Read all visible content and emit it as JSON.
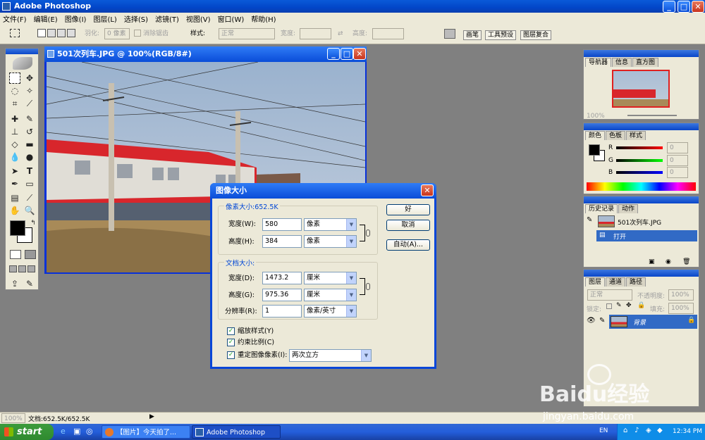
{
  "app": {
    "title": "Adobe Photoshop"
  },
  "menu": [
    "文件(F)",
    "编辑(E)",
    "图像(I)",
    "图层(L)",
    "选择(S)",
    "滤镜(T)",
    "视图(V)",
    "窗口(W)",
    "帮助(H)"
  ],
  "options": {
    "feather_label": "羽化:",
    "feather_value": "0 像素",
    "antialias_label": "消除锯齿",
    "style_label": "样式:",
    "style_value": "正常",
    "width_label": "宽度:",
    "height_label": "高度:",
    "tabs": [
      "画笔",
      "工具预设",
      "图层复合"
    ]
  },
  "document": {
    "title": "501次列车.JPG @ 100%(RGB/8#)"
  },
  "dialog": {
    "title": "图像大小",
    "pixel_group": "像素大小:652.5K",
    "px_width_label": "宽度(W):",
    "px_width_value": "580",
    "px_width_unit": "像素",
    "px_height_label": "高度(H):",
    "px_height_value": "384",
    "px_height_unit": "像素",
    "doc_group": "文档大小:",
    "doc_width_label": "宽度(D):",
    "doc_width_value": "1473.2",
    "doc_width_unit": "厘米",
    "doc_height_label": "高度(G):",
    "doc_height_value": "975.36",
    "doc_height_unit": "厘米",
    "res_label": "分辨率(R):",
    "res_value": "1",
    "res_unit": "像素/英寸",
    "scale_styles": "缩放样式(Y)",
    "constrain": "约束比例(C)",
    "resample": "重定图像像素(I):",
    "resample_method": "两次立方",
    "ok": "好",
    "cancel": "取消",
    "auto": "自动(A)..."
  },
  "navigator": {
    "tabs": [
      "导航器",
      "信息",
      "直方图"
    ],
    "zoom": "100%"
  },
  "color_panel": {
    "tabs": [
      "颜色",
      "色板",
      "样式"
    ],
    "r_label": "R",
    "g_label": "G",
    "b_label": "B",
    "r": "0",
    "g": "0",
    "b": "0"
  },
  "history": {
    "tabs": [
      "历史记录",
      "动作"
    ],
    "snapshot": "501次列车.JPG",
    "step": "打开"
  },
  "layers": {
    "tabs": [
      "图层",
      "通道",
      "路径"
    ],
    "blend": "正常",
    "opacity_label": "不透明度:",
    "opacity": "100%",
    "lock_label": "锁定:",
    "fill_label": "填充:",
    "fill": "100%",
    "layer_name": "背景"
  },
  "statusbar": {
    "zoom": "100%",
    "doc": "文档:652.5K/652.5K"
  },
  "taskbar": {
    "start": "start",
    "task1": "【图片】今天拍了...",
    "task2": "Adobe Photoshop",
    "lang": "EN",
    "clock": "12:34 PM"
  },
  "watermark": {
    "brand": "Baidu经验",
    "url": "jingyan.baidu.com"
  },
  "colors": {
    "accent": "#0a4cd8",
    "panel": "#ece9d8",
    "train_red": "#d8262c"
  }
}
